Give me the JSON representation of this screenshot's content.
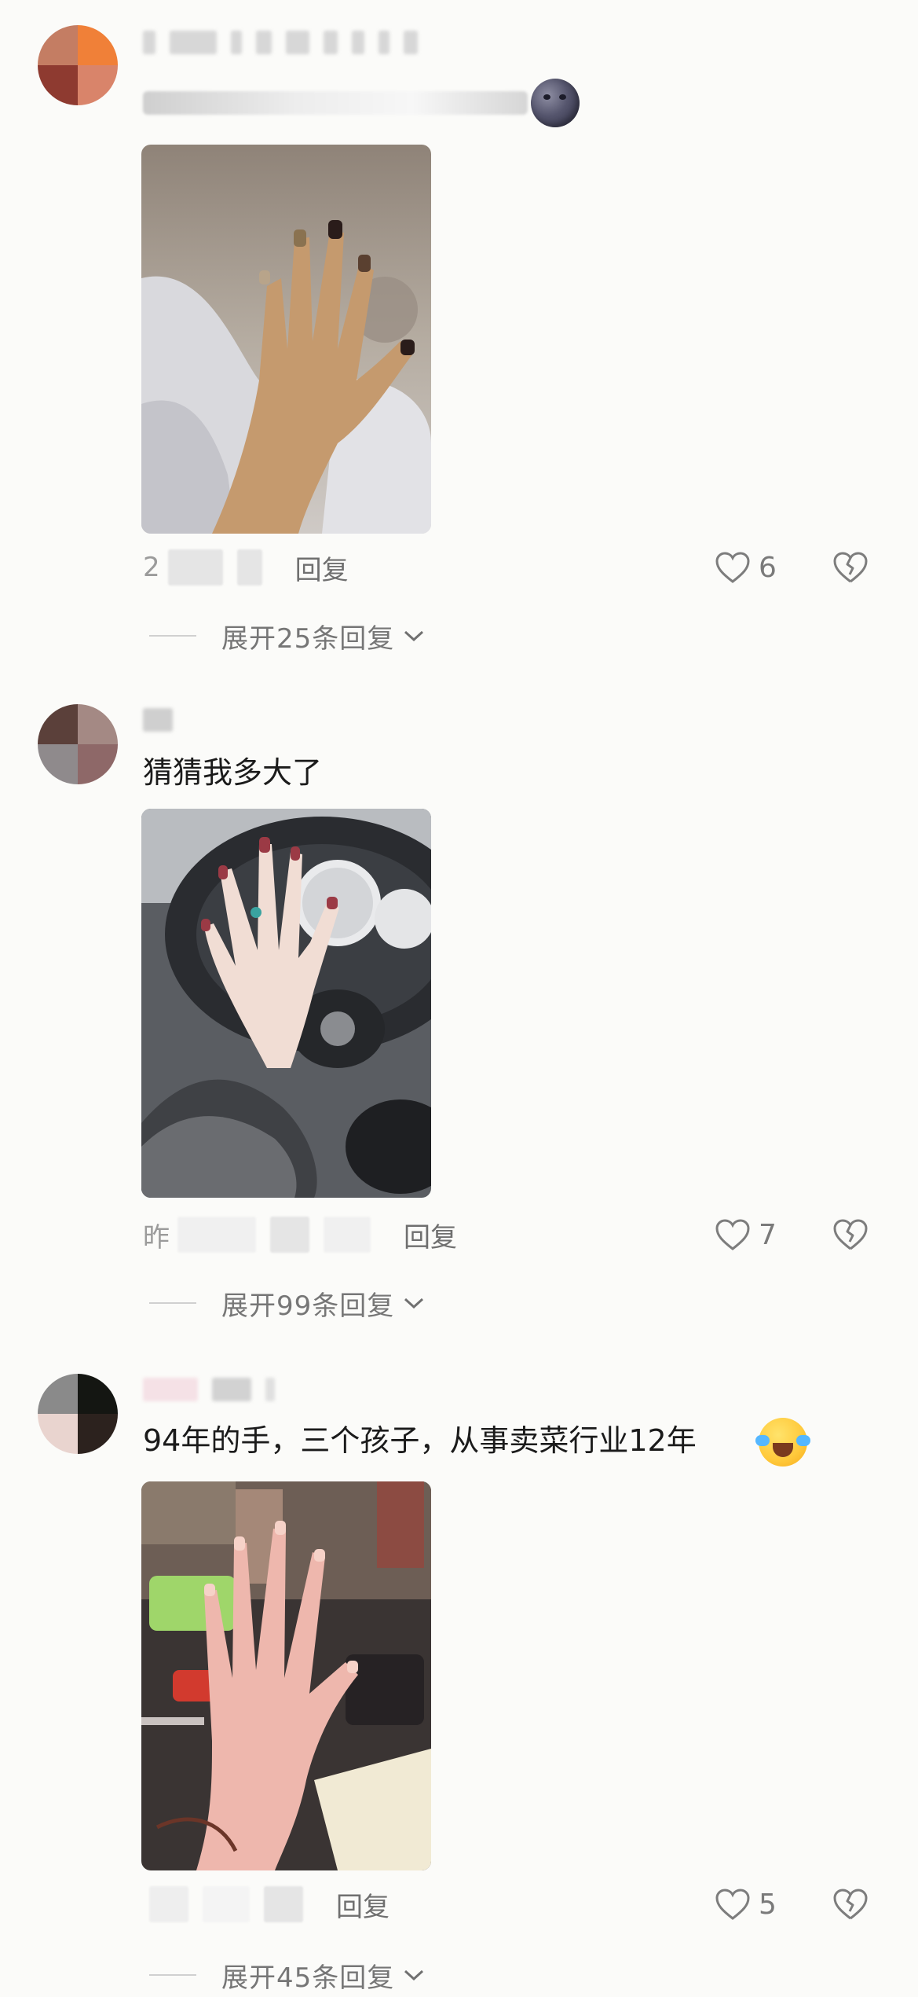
{
  "comments": [
    {
      "avatar_colors": [
        "#c47d63",
        "#f08038",
        "#8e3a30",
        "#d9846a"
      ],
      "text": "",
      "emoji": "moon-face",
      "meta_prefix": "2",
      "reply_label": "回复",
      "like_count": "6",
      "expand_label": "展开25条回复"
    },
    {
      "avatar_colors": [
        "#5b403a",
        "#a48984",
        "#8f8a8c",
        "#8e6868"
      ],
      "text": "猜猜我多大了",
      "meta_prefix": "昨",
      "reply_label": "回复",
      "like_count": "7",
      "expand_label": "展开99条回复"
    },
    {
      "avatar_colors": [
        "#8a8a8a",
        "#141612",
        "#e9d4cf",
        "#2c221e"
      ],
      "text": "94年的手，三个孩子，从事卖菜行业12年",
      "emoji": "crying-laughing",
      "meta_prefix": "",
      "reply_label": "回复",
      "like_count": "5",
      "expand_label": "展开45条回复"
    }
  ]
}
